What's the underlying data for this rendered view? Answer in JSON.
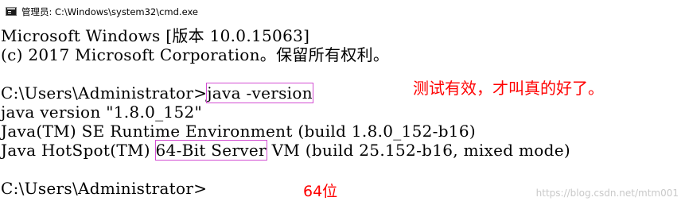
{
  "window": {
    "title": "管理员: C:\\Windows\\system32\\cmd.exe",
    "icon": "cmd-console-icon"
  },
  "console": {
    "lines": [
      "Microsoft Windows [版本 10.0.15063]",
      "(c) 2017 Microsoft Corporation。保留所有权利。",
      "",
      "C:\\Users\\Administrator>",
      "java version \"1.8.0_152\"",
      "Java(TM) SE Runtime Environment (build 1.8.0_152-b16)",
      "Java HotSpot(TM) ",
      "",
      "C:\\Users\\Administrator>"
    ],
    "command": "java -version",
    "hotspot_highlight": "64-Bit Server",
    "hotspot_rest": " VM (build 25.152-b16, mixed mode)"
  },
  "annotations": {
    "test_note": "测试有效，才叫真的好了。",
    "bits_note": "64位",
    "color": "#ff0000",
    "highlight_color": "#d34fd3"
  },
  "watermark": "https://blog.csdn.net/mtm001"
}
